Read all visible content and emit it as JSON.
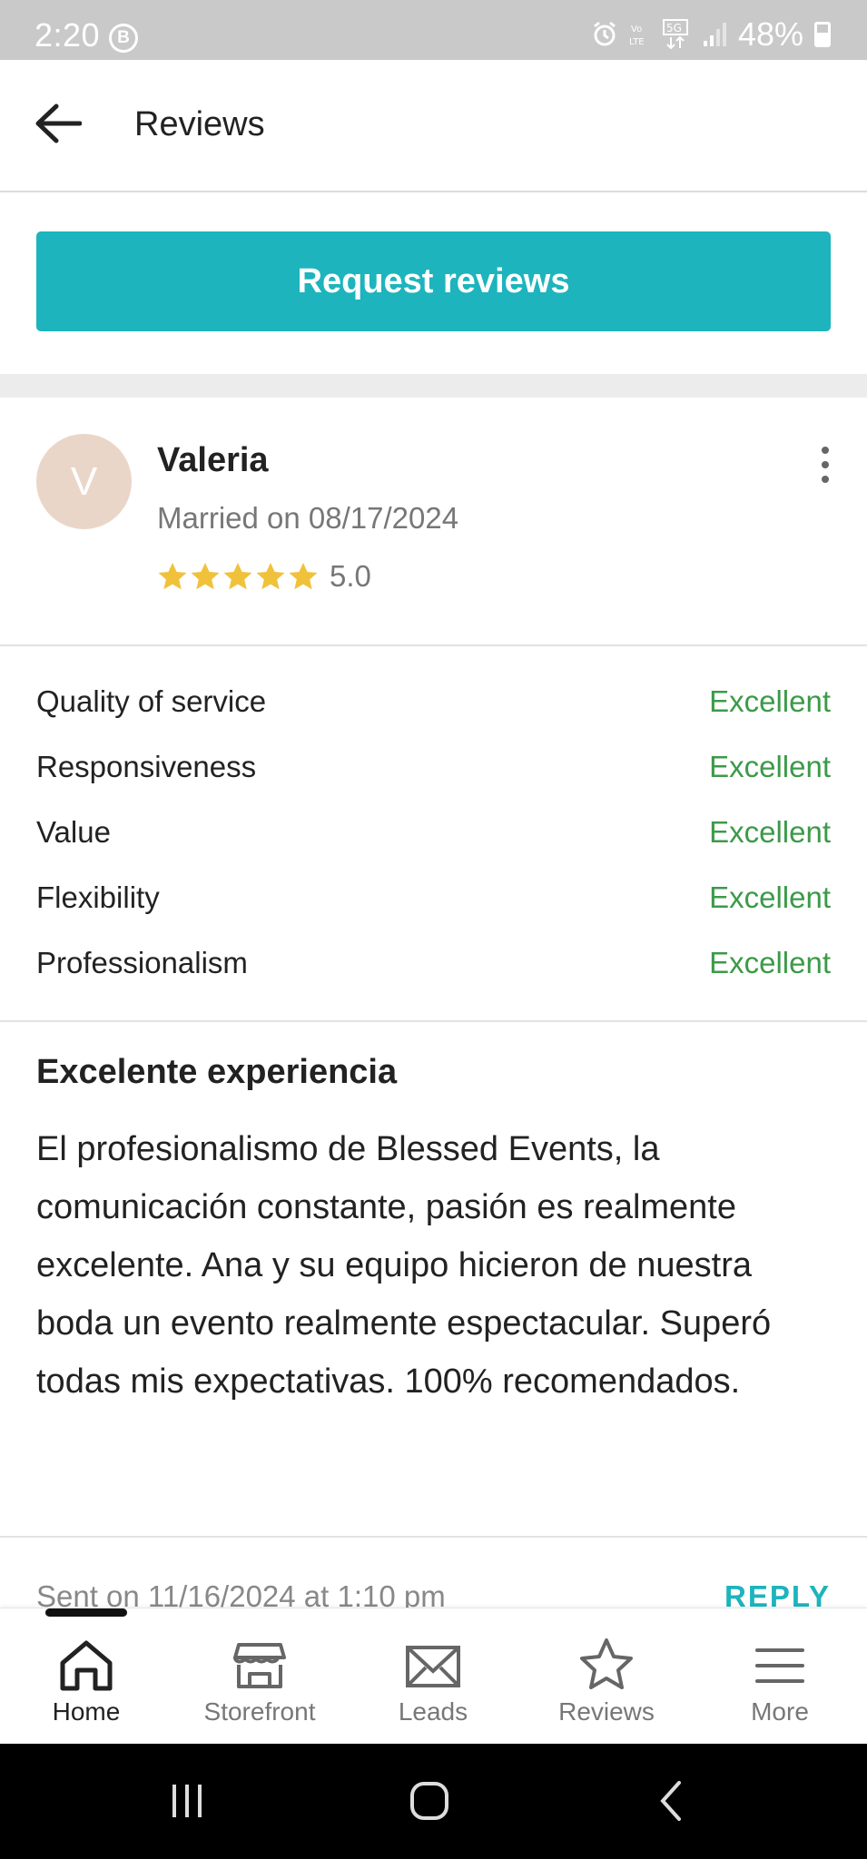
{
  "status_bar": {
    "time": "2:20",
    "badge": "B",
    "battery_percent": "48%",
    "network": "5G",
    "volte": "LTE"
  },
  "header": {
    "title": "Reviews",
    "back_icon": "arrow-left-icon"
  },
  "request_button": {
    "label": "Request reviews",
    "color": "#1db4bd"
  },
  "review": {
    "avatar_initial": "V",
    "avatar_color": "#ead6c8",
    "name": "Valeria",
    "married_on": "Married on 08/17/2024",
    "rating_value": "5.0",
    "stars": 5,
    "star_color": "#f0c23b",
    "criteria": [
      {
        "label": "Quality of service",
        "value": "Excellent"
      },
      {
        "label": "Responsiveness",
        "value": "Excellent"
      },
      {
        "label": "Value",
        "value": "Excellent"
      },
      {
        "label": "Flexibility",
        "value": "Excellent"
      },
      {
        "label": "Professionalism",
        "value": "Excellent"
      }
    ],
    "title": "Excelente experiencia",
    "body": "El profesionalismo de Blessed Events, la comunicación constante, pasión es realmente excelente. Ana y su equipo hicieron de nuestra boda un evento realmente espectacular. Superó todas mis expectativas. 100% recomendados.",
    "sent": "Sent on 11/16/2024 at 1:10 pm",
    "reply_label": "REPLY"
  },
  "bottom_nav": [
    {
      "label": "Home",
      "icon": "home-icon",
      "active": true
    },
    {
      "label": "Storefront",
      "icon": "storefront-icon",
      "active": false
    },
    {
      "label": "Leads",
      "icon": "envelope-icon",
      "active": false
    },
    {
      "label": "Reviews",
      "icon": "star-icon",
      "active": false
    },
    {
      "label": "More",
      "icon": "menu-icon",
      "active": false
    }
  ],
  "colors": {
    "accent": "#1db4bd",
    "excellent_green": "#3c9a49"
  }
}
